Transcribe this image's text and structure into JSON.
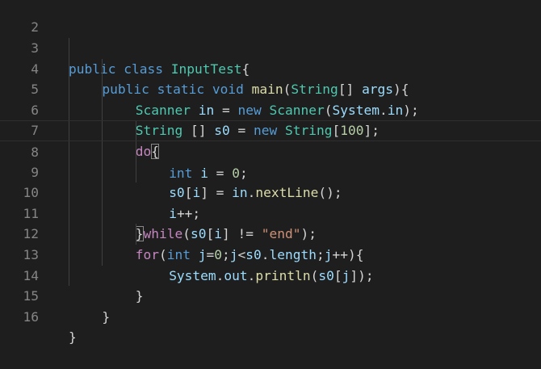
{
  "editor": {
    "lines": [
      {
        "number": "2",
        "tokens": []
      },
      {
        "number": "3",
        "tokens": [
          {
            "t": "public",
            "c": "kw"
          },
          {
            "t": " ",
            "c": "op"
          },
          {
            "t": "class",
            "c": "kw"
          },
          {
            "t": " ",
            "c": "op"
          },
          {
            "t": "InputTest",
            "c": "ty"
          },
          {
            "t": "{",
            "c": "op"
          }
        ]
      },
      {
        "number": "4",
        "tokens": [
          {
            "t": "public",
            "c": "kw"
          },
          {
            "t": " ",
            "c": "op"
          },
          {
            "t": "static",
            "c": "kw"
          },
          {
            "t": " ",
            "c": "op"
          },
          {
            "t": "void",
            "c": "kw"
          },
          {
            "t": " ",
            "c": "op"
          },
          {
            "t": "main",
            "c": "fn"
          },
          {
            "t": "(",
            "c": "op"
          },
          {
            "t": "String",
            "c": "ty"
          },
          {
            "t": "[] ",
            "c": "op"
          },
          {
            "t": "args",
            "c": "var"
          },
          {
            "t": "){",
            "c": "op"
          }
        ]
      },
      {
        "number": "5",
        "tokens": [
          {
            "t": "Scanner",
            "c": "ty"
          },
          {
            "t": " ",
            "c": "op"
          },
          {
            "t": "in",
            "c": "var"
          },
          {
            "t": " = ",
            "c": "op"
          },
          {
            "t": "new",
            "c": "kw"
          },
          {
            "t": " ",
            "c": "op"
          },
          {
            "t": "Scanner",
            "c": "ty"
          },
          {
            "t": "(",
            "c": "op"
          },
          {
            "t": "System",
            "c": "var"
          },
          {
            "t": ".",
            "c": "op"
          },
          {
            "t": "in",
            "c": "var"
          },
          {
            "t": ");",
            "c": "op"
          }
        ]
      },
      {
        "number": "6",
        "tokens": [
          {
            "t": "String",
            "c": "ty"
          },
          {
            "t": " [] ",
            "c": "op"
          },
          {
            "t": "s0",
            "c": "var"
          },
          {
            "t": " = ",
            "c": "op"
          },
          {
            "t": "new",
            "c": "kw"
          },
          {
            "t": " ",
            "c": "op"
          },
          {
            "t": "String",
            "c": "ty"
          },
          {
            "t": "[",
            "c": "op"
          },
          {
            "t": "100",
            "c": "num"
          },
          {
            "t": "];",
            "c": "op"
          }
        ]
      },
      {
        "number": "7",
        "tokens": [
          {
            "t": "do",
            "c": "ctl"
          },
          {
            "t": "{",
            "c": "op",
            "m": true
          }
        ]
      },
      {
        "number": "8",
        "current": true,
        "tokens": [
          {
            "t": "int",
            "c": "kw"
          },
          {
            "t": " ",
            "c": "op"
          },
          {
            "t": "i",
            "c": "var"
          },
          {
            "t": " = ",
            "c": "op"
          },
          {
            "t": "0",
            "c": "num"
          },
          {
            "t": ";",
            "c": "op"
          }
        ]
      },
      {
        "number": "9",
        "tokens": [
          {
            "t": "s0",
            "c": "var"
          },
          {
            "t": "[",
            "c": "op"
          },
          {
            "t": "i",
            "c": "var"
          },
          {
            "t": "] = ",
            "c": "op"
          },
          {
            "t": "in",
            "c": "var"
          },
          {
            "t": ".",
            "c": "op"
          },
          {
            "t": "nextLine",
            "c": "fn"
          },
          {
            "t": "();",
            "c": "op"
          }
        ]
      },
      {
        "number": "10",
        "tokens": [
          {
            "t": "i",
            "c": "var"
          },
          {
            "t": "++;",
            "c": "op"
          }
        ]
      },
      {
        "number": "11",
        "tokens": [
          {
            "t": "}",
            "c": "op",
            "m": true
          },
          {
            "t": "while",
            "c": "ctl"
          },
          {
            "t": "(",
            "c": "op"
          },
          {
            "t": "s0",
            "c": "var"
          },
          {
            "t": "[",
            "c": "op"
          },
          {
            "t": "i",
            "c": "var"
          },
          {
            "t": "] != ",
            "c": "op"
          },
          {
            "t": "\"end\"",
            "c": "str"
          },
          {
            "t": ");",
            "c": "op"
          }
        ]
      },
      {
        "number": "12",
        "tokens": [
          {
            "t": "for",
            "c": "ctl"
          },
          {
            "t": "(",
            "c": "op"
          },
          {
            "t": "int",
            "c": "kw"
          },
          {
            "t": " ",
            "c": "op"
          },
          {
            "t": "j",
            "c": "var"
          },
          {
            "t": "=",
            "c": "op"
          },
          {
            "t": "0",
            "c": "num"
          },
          {
            "t": ";",
            "c": "op"
          },
          {
            "t": "j",
            "c": "var"
          },
          {
            "t": "<",
            "c": "op"
          },
          {
            "t": "s0",
            "c": "var"
          },
          {
            "t": ".",
            "c": "op"
          },
          {
            "t": "length",
            "c": "var"
          },
          {
            "t": ";",
            "c": "op"
          },
          {
            "t": "j",
            "c": "var"
          },
          {
            "t": "++){",
            "c": "op"
          }
        ]
      },
      {
        "number": "13",
        "tokens": [
          {
            "t": "System",
            "c": "var"
          },
          {
            "t": ".",
            "c": "op"
          },
          {
            "t": "out",
            "c": "var"
          },
          {
            "t": ".",
            "c": "op"
          },
          {
            "t": "println",
            "c": "fn"
          },
          {
            "t": "(",
            "c": "op"
          },
          {
            "t": "s0",
            "c": "var"
          },
          {
            "t": "[",
            "c": "op"
          },
          {
            "t": "j",
            "c": "var"
          },
          {
            "t": "]);",
            "c": "op"
          }
        ]
      },
      {
        "number": "14",
        "tokens": [
          {
            "t": "}",
            "c": "op"
          }
        ]
      },
      {
        "number": "15",
        "tokens": [
          {
            "t": "}",
            "c": "op"
          }
        ]
      },
      {
        "number": "16",
        "tokens": [
          {
            "t": "}",
            "c": "op"
          }
        ]
      }
    ]
  }
}
